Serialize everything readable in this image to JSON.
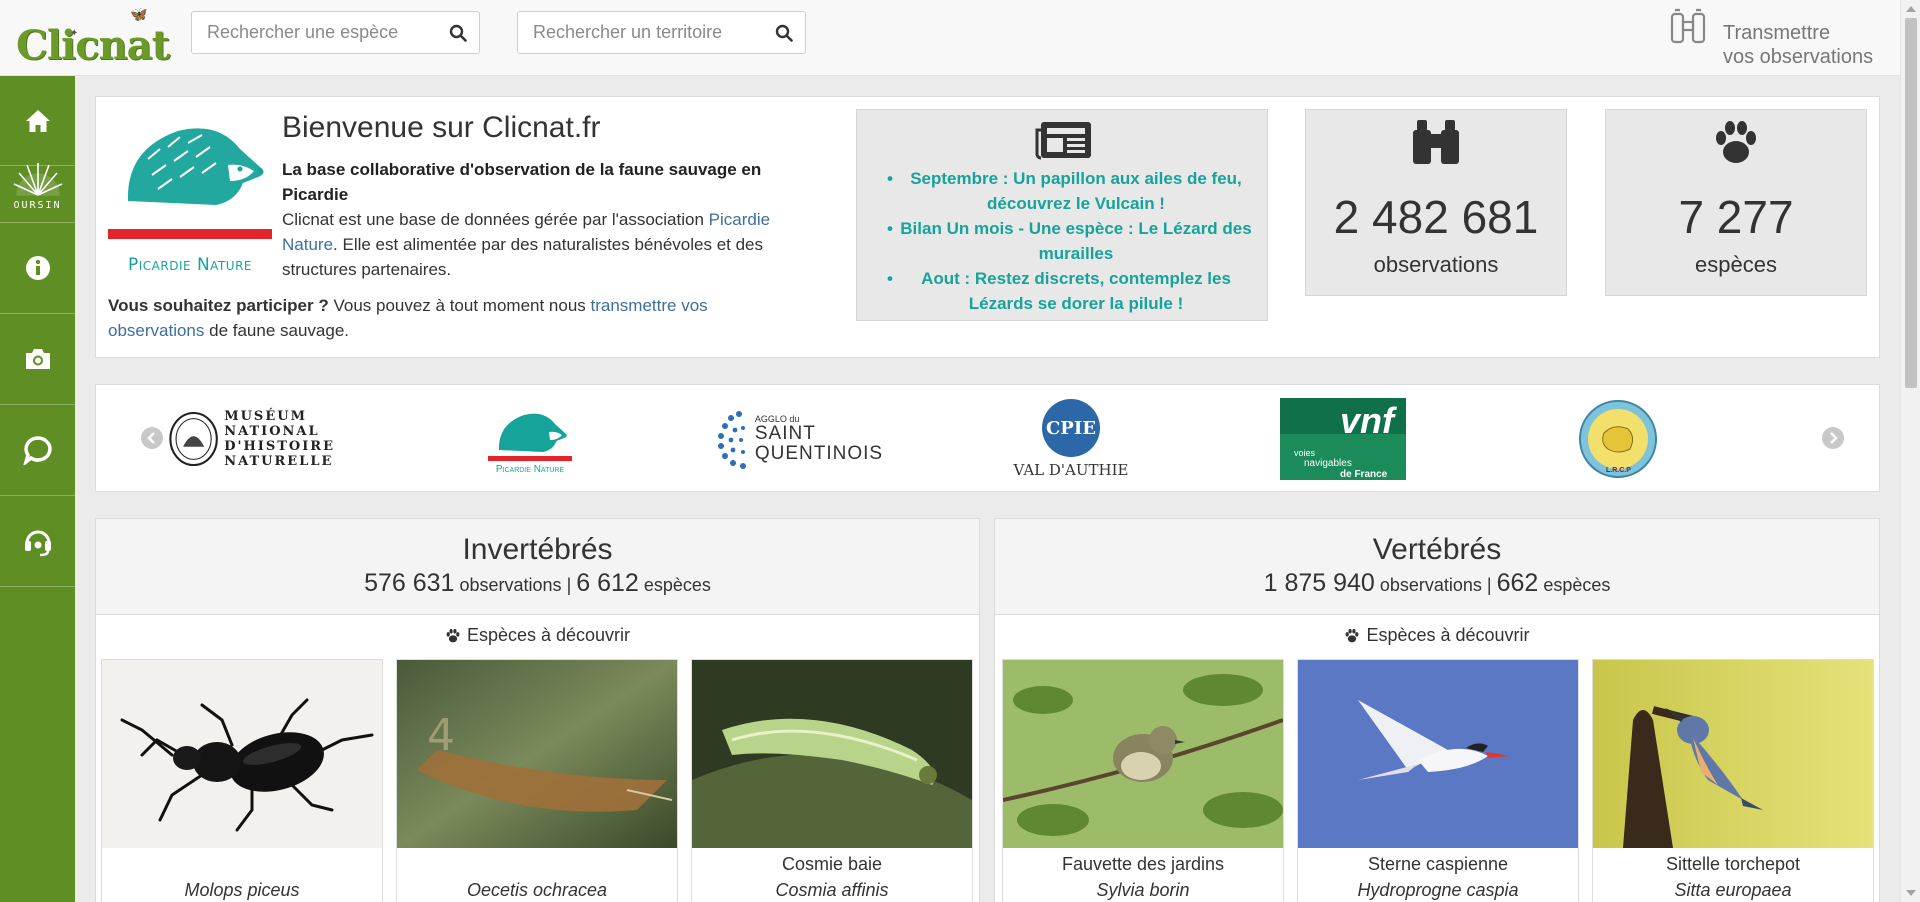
{
  "header": {
    "logo_text": "Clicnat",
    "species_search_placeholder": "Rechercher une espèce",
    "territory_search_placeholder": "Rechercher un territoire",
    "transmit_line1": "Transmettre",
    "transmit_line2": "vos observations"
  },
  "sidebar": {
    "items": [
      {
        "name": "home",
        "icon": "home-icon"
      },
      {
        "name": "oursin",
        "icon": "oursin-logo",
        "label": "OURSIN"
      },
      {
        "name": "info",
        "icon": "info-icon"
      },
      {
        "name": "photos",
        "icon": "camera-icon"
      },
      {
        "name": "forum",
        "icon": "chat-icon"
      },
      {
        "name": "support",
        "icon": "headset-icon"
      }
    ],
    "color": "#5f8e24"
  },
  "welcome": {
    "org_name": "Picardie Nature",
    "title": "Bienvenue sur Clicnat.fr",
    "subtitle": "La base collaborative d'observation de la faune sauvage en Picardie",
    "p1_before": "Clicnat est une base de données gérée par l'association ",
    "p1_link": "Picardie Nature",
    "p1_after": ". Elle est alimentée par des naturalistes bénévoles et des structures partenaires.",
    "p2_bold": "Vous souhaitez participer ?",
    "p2_before": " Vous pouvez à tout moment nous ",
    "p2_link": "transmettre vos observations",
    "p2_after": " de faune sauvage."
  },
  "news": {
    "items": [
      "Septembre : Un papillon aux ailes de feu, découvrez le Vulcain !",
      "Bilan Un mois - Une espèce : Le Lézard des murailles",
      "Aout : Restez discrets, contemplez les Lézards se dorer la pilule !"
    ],
    "color": "#16a39a"
  },
  "stats": {
    "observations_value": "2 482 681",
    "observations_label": "observations",
    "species_value": "7 277",
    "species_label": "espèces"
  },
  "partners": {
    "museum_line1": "MUSÉUM",
    "museum_line2": "NATIONAL",
    "museum_line3": "D'HISTOIRE",
    "museum_line4": "NATURELLE",
    "picardie": "Picardie Nature",
    "agglo_small": "AGGLO du",
    "agglo_line1": "SAINT",
    "agglo_line2": "QUENTINOIS",
    "cpie_logo": "CPIE",
    "cpie": "VAL D'AUTHIE",
    "vnf_logo": "vnf",
    "vnf_line1": "voies",
    "vnf_line2": "navigables",
    "vnf_line3": "de France",
    "lrcp": "L.R.C.P"
  },
  "invertebrates": {
    "title": "Invertébrés",
    "obs_count": "576 631",
    "obs_label": "observations",
    "sep": "|",
    "species_count": "6 612",
    "species_label": "espèces",
    "discover_label": "Espèces à découvrir",
    "cards": [
      {
        "common": "",
        "scientific": "Molops piceus"
      },
      {
        "common": "",
        "scientific": "Oecetis ochracea"
      },
      {
        "common": "Cosmie baie",
        "scientific": "Cosmia affinis"
      }
    ]
  },
  "vertebrates": {
    "title": "Vertébrés",
    "obs_count": "1 875 940",
    "obs_label": "observations",
    "sep": "|",
    "species_count": "662",
    "species_label": "espèces",
    "discover_label": "Espèces à découvrir",
    "cards": [
      {
        "common": "Fauvette des jardins",
        "scientific": "Sylvia borin"
      },
      {
        "common": "Sterne caspienne",
        "scientific": "Hydroprogne caspia"
      },
      {
        "common": "Sittelle torchepot",
        "scientific": "Sitta europaea"
      }
    ]
  }
}
